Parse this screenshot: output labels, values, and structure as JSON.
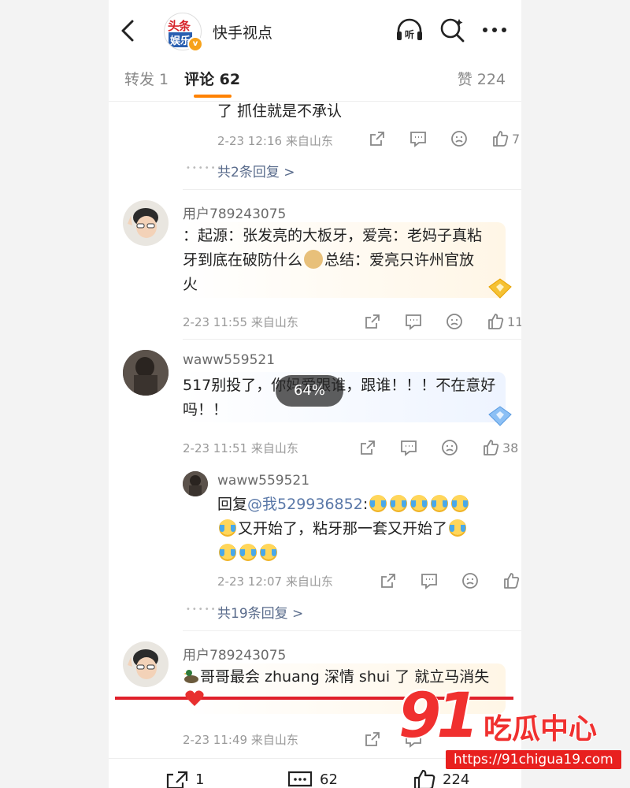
{
  "header": {
    "account_name": "快手视点",
    "brand_line1": "头条",
    "brand_line2": "娱乐",
    "verified_mark": "v",
    "icons": [
      "back-icon",
      "listen-icon",
      "search-icon",
      "more-icon"
    ],
    "listen_label": "听"
  },
  "tabs": {
    "repost": "转发 1",
    "comments": "评论 62",
    "likes": "赞 224",
    "accent": "#ff8200"
  },
  "comments": [
    {
      "partial_text": "了 抓住就是不承认",
      "time": "2-23 12:16",
      "location": "来自山东",
      "likes": "7",
      "more_replies": "共2条回复 >"
    },
    {
      "user": "用户789243075",
      "line1": "：起源：张发亮的大板牙，爱亮：老妈子真粘",
      "line2a": "牙到底在破防什么",
      "line2b": "总结：爱亮只许州官放",
      "line3": "火",
      "time": "2-23 11:55",
      "location": "来自山东",
      "likes": "11"
    },
    {
      "user": "waww559521",
      "line1": "517别投了，你妈爱跟谁，跟谁！！！不在意好",
      "line2": "吗！！",
      "time": "2-23 11:51",
      "location": "来自山东",
      "likes": "38",
      "reply": {
        "user": "waww559521",
        "prefix": "回复",
        "mention": "@我529936852",
        "line2": "又开始了，粘牙那一套又开始了",
        "time": "2-23 12:07",
        "location": "来自山东"
      },
      "more_replies": "共19条回复 >"
    },
    {
      "user": "用户789243075",
      "text": "哥哥最会 zhuang 深情 shui 了 就立马消失",
      "time": "2-23 11:49",
      "location": "来自山东"
    }
  ],
  "overlay": {
    "percent": "64%"
  },
  "bottom_bar": {
    "repost_count": "1",
    "comment_count": "62",
    "like_count": "224"
  },
  "watermark": {
    "number": "91",
    "text": "吃瓜中心",
    "url": "https://91chigua19.com"
  }
}
